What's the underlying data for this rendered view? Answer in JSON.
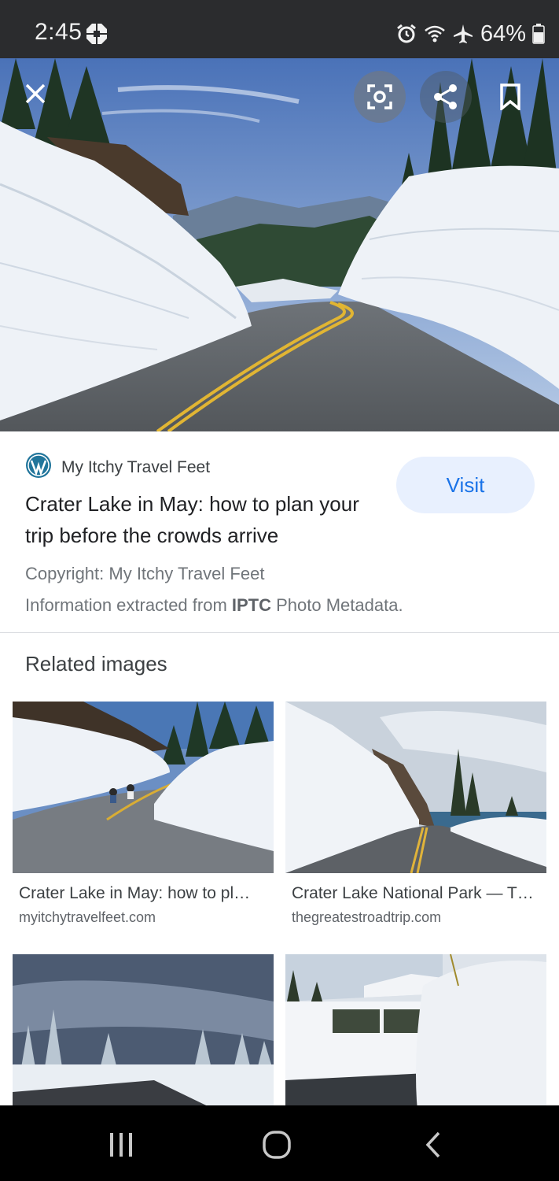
{
  "status_bar": {
    "time": "2:45",
    "battery": "64%",
    "icons": [
      "chase-icon",
      "alarm-icon",
      "wifi-icon",
      "airplane-mode-icon",
      "battery-icon"
    ]
  },
  "viewer": {
    "buttons": [
      "close-icon",
      "google-lens-icon",
      "share-icon",
      "bookmark-icon"
    ]
  },
  "result": {
    "source_name": "My Itchy Travel Feet",
    "title": "Crater Lake in May: how to plan your trip before the crowds arrive",
    "visit_label": "Visit",
    "copyright": "Copyright: My Itchy Travel Feet",
    "metadata_prefix": "Information extracted from ",
    "metadata_strong": "IPTC",
    "metadata_suffix": " Photo Metadata."
  },
  "related": {
    "heading": "Related images",
    "items": [
      {
        "title": "Crater Lake in May: how to pl…",
        "domain": "myitchytravelfeet.com"
      },
      {
        "title": "Crater Lake National Park — T…",
        "domain": "thegreatestroadtrip.com"
      },
      {
        "title": "",
        "domain": ""
      },
      {
        "title": "",
        "domain": ""
      }
    ]
  },
  "nav_bar": {
    "buttons": [
      "recent-apps-icon",
      "home-icon",
      "back-icon"
    ]
  },
  "colors": {
    "accent": "#1a73e8",
    "visit_bg": "#e8f0fe",
    "status_bg": "#2b2c2e",
    "nav_bg": "#000000"
  }
}
